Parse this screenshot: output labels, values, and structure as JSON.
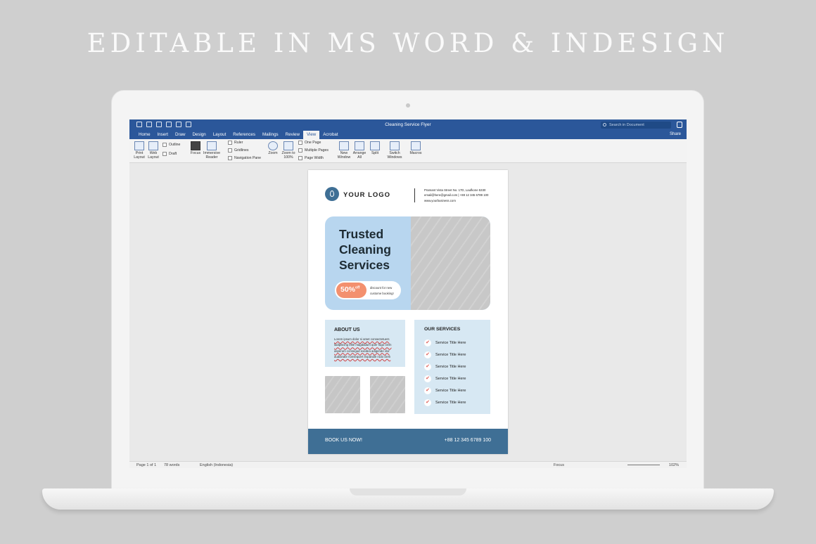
{
  "headline": "EDITABLE IN MS WORD & INDESIGN",
  "word": {
    "doc_title": "Cleaning Service Flyer",
    "search_placeholder": "Search in Document",
    "tabs": [
      "Home",
      "Insert",
      "Draw",
      "Design",
      "Layout",
      "References",
      "Mailings",
      "Review",
      "View",
      "Acrobat"
    ],
    "active_tab": "View",
    "share_label": "Share",
    "ribbon": {
      "print_layout": "Print Layout",
      "web_layout": "Web Layout",
      "outline": "Outline",
      "draft": "Draft",
      "focus": "Focus",
      "immersive_reader": "Immersive Reader",
      "ruler": "Ruler",
      "gridlines": "Gridlines",
      "navigation_pane": "Navigation Pane",
      "zoom": "Zoom",
      "zoom_100": "Zoom to 100%",
      "one_page": "One Page",
      "multiple_pages": "Multiple Pages",
      "page_width": "Page Width",
      "new_window": "New Window",
      "arrange_all": "Arrange All",
      "split": "Split",
      "switch_windows": "Switch Windows",
      "macros": "Macros"
    },
    "status": {
      "page": "Page 1 of 1",
      "words": "78 words",
      "language": "English (Indonesia)",
      "focus": "Focus",
      "zoom": "102%"
    }
  },
  "flyer": {
    "logo_text": "YOUR LOGO",
    "contact": {
      "address": "Pramant Vista Street No. 17D, Laufkone 5330",
      "email_phone": "email@here@gmail.com | +88 12 345 6789 100",
      "website": "www.yourbusiness.com"
    },
    "hero_title_1": "Trusted",
    "hero_title_2": "Cleaning",
    "hero_title_3": "Services",
    "discount": "50%",
    "discount_suffix": "off",
    "discount_text_1": "discount for new",
    "discount_text_2": "custome booking!",
    "about_title": "ABOUT US",
    "about_text": "Lorem ipsum dolor si amet consectetuers ladipiscing elite magdadum quer fugo clem asperum consegud exedea adigende vlor audianate nonsequert expandie rodo clem",
    "services_title": "OUR SERVICES",
    "services": [
      "Service Title Here",
      "Service Title Here",
      "Service Title Here",
      "Service Title Here",
      "Service Title Here",
      "Service Title Here"
    ],
    "cta": "BOOK US NOW!",
    "phone": "+88 12 345 6789 100"
  },
  "colors": {
    "word_blue": "#2b579a",
    "flyer_blue": "#3f6f95",
    "hero_blue": "#b8d6ef",
    "accent_orange": "#f3906e"
  }
}
